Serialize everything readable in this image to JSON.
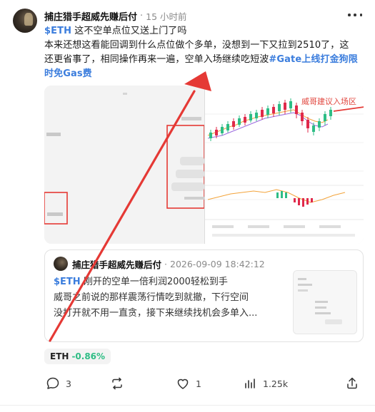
{
  "post": {
    "author": "捕庄猎手超威先赚后付",
    "separator": "·",
    "time_ago": "15 小时前",
    "body": {
      "line1": {
        "cashtag": "$ETH",
        "text": " 这不空单点位又送上门了吗"
      },
      "line2": "本来还想这看能回调到什么点位做个多单，没想到一下又拉到2510了，这",
      "line3": "还更省事了，相同操作再来一遍，空单入场继续吃短波",
      "line3_hashtag": "#Gate上线打金狗限",
      "line4_hashtag": "时免Gas费"
    },
    "media": {
      "annotation": "威哥建议入场区"
    },
    "quote": {
      "author": "捕庄猎手超威先赚后付",
      "separator": "·",
      "timestamp": "2026-09-09 18:42:12",
      "line1": {
        "cashtag": "$ETH",
        "text": " 刚开的空单一倍利润2000轻松到手"
      },
      "line2": "威哥之前说的那样震荡行情吃到就撤，下行空间",
      "line3": "没打开就不用一直贪，接下来继续找机会多单入..."
    },
    "coin": {
      "symbol": "ETH",
      "change": "-0.86%"
    },
    "actions": {
      "comments": "3",
      "reposts": "",
      "likes": "1",
      "views": "1.25k"
    },
    "colors": {
      "link": "#3b7ddd",
      "positive": "#2ebd85",
      "annotation_red": "#e1473f",
      "arrow_red": "#e53935"
    }
  }
}
